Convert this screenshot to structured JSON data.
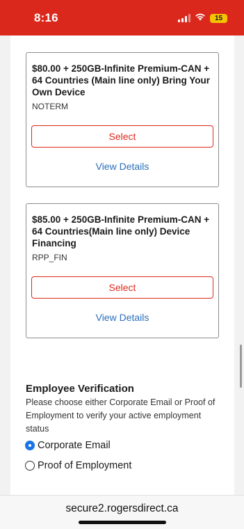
{
  "status_bar": {
    "time": "8:16",
    "battery": "15",
    "colors": {
      "background": "#da291c",
      "battery": "#f5c400"
    }
  },
  "plans": [
    {
      "title": "$80.00 + 250GB-Infinite Premium-CAN + 64 Countries (Main line only) Bring Your Own Device",
      "code": "NOTERM",
      "select_label": "Select",
      "details_label": "View Details"
    },
    {
      "title": "$85.00 + 250GB-Infinite Premium-CAN + 64 Countries(Main line only) Device Financing",
      "code": "RPP_FIN",
      "select_label": "Select",
      "details_label": "View Details"
    }
  ],
  "verification": {
    "title": "Employee Verification",
    "description": "Please choose either Corporate Email or Proof of Employment to verify your active employment status",
    "options": [
      {
        "label": "Corporate Email",
        "selected": true
      },
      {
        "label": "Proof of Employment",
        "selected": false
      }
    ]
  },
  "browser": {
    "url": "secure2.rogersdirect.ca"
  },
  "icons": [
    "signal-icon",
    "wifi-icon",
    "battery-icon"
  ],
  "colors": {
    "accent": "#da291c",
    "link": "#2a6ebb",
    "radio_selected": "#1a73e8"
  }
}
